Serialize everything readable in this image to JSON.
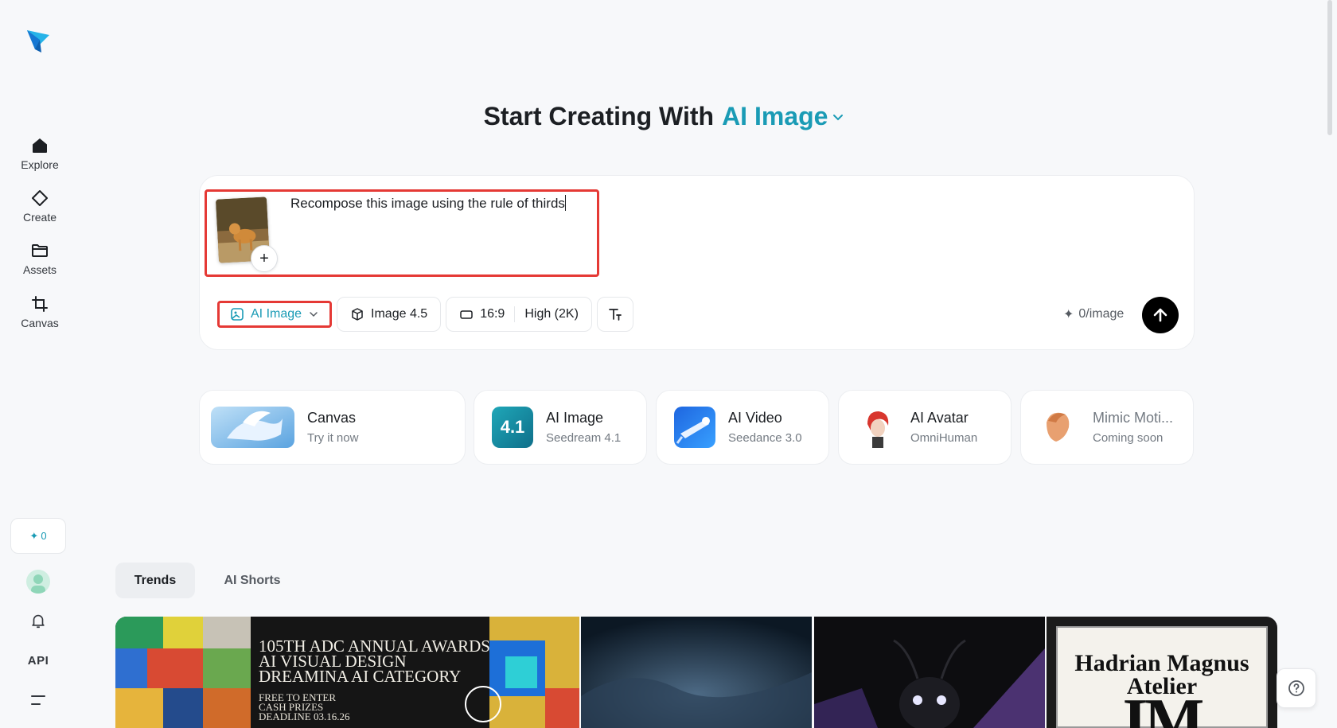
{
  "sidebar": {
    "items": [
      {
        "label": "Explore",
        "icon": "home-icon"
      },
      {
        "label": "Create",
        "icon": "diamond-icon"
      },
      {
        "label": "Assets",
        "icon": "folder-icon"
      },
      {
        "label": "Canvas",
        "icon": "crop-icon"
      }
    ],
    "credits": "0",
    "api_label": "API"
  },
  "header": {
    "title_prefix": "Start Creating With",
    "title_accent": "AI Image"
  },
  "prompt": {
    "text": "Recompose this image using the rule of thirds",
    "add_symbol": "+"
  },
  "toolbar": {
    "mode_label": "AI Image",
    "model_label": "Image 4.5",
    "ratio_label": "16:9",
    "quality_label": "High (2K)",
    "cost_label": "0/image"
  },
  "features": [
    {
      "name": "Canvas",
      "sub": "Try it now"
    },
    {
      "name": "AI Image",
      "sub": "Seedream 4.1",
      "badge": "4.1"
    },
    {
      "name": "AI Video",
      "sub": "Seedance 3.0"
    },
    {
      "name": "AI Avatar",
      "sub": "OmniHuman"
    },
    {
      "name": "Mimic Moti...",
      "sub": "Coming soon"
    }
  ],
  "tabs": [
    {
      "label": "Trends",
      "active": true
    },
    {
      "label": "AI Shorts",
      "active": false
    }
  ],
  "gallery": {
    "tile1_lines": [
      "105TH ADC ANNUAL AWARDS",
      "AI VISUAL DESIGN",
      "DREAMINA AI CATEGORY"
    ],
    "tile1_sub": [
      "FREE TO ENTER",
      "CASH PRIZES",
      "DEADLINE 03.16.26"
    ],
    "tile4_title": "Hadrian Magnus",
    "tile4_sub": "Atelier",
    "tile4_letters": "IM"
  },
  "colors": {
    "accent": "#1a9bb5",
    "highlight_border": "#e53935",
    "send_button": "#000000"
  }
}
